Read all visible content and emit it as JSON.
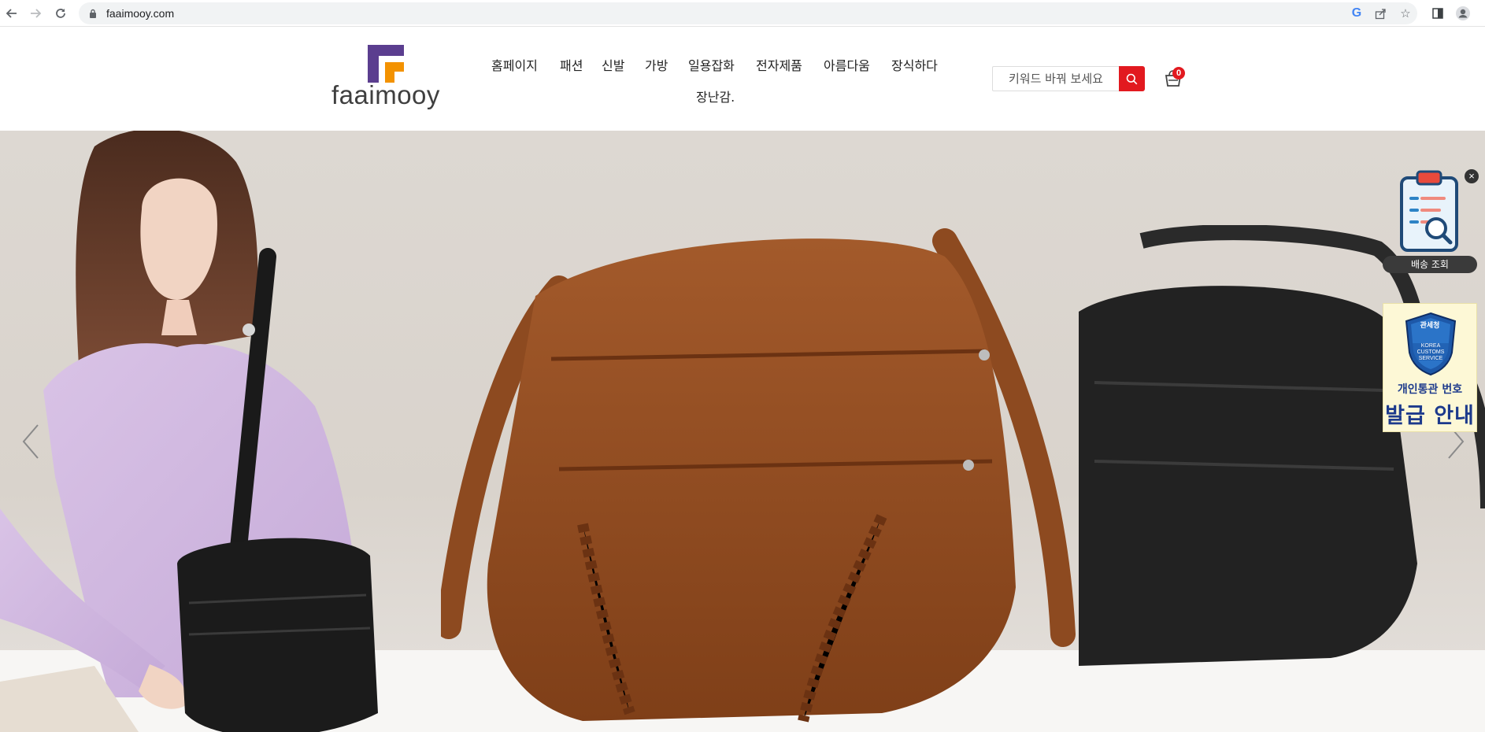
{
  "browser": {
    "url": "faaimooy.com",
    "icons": [
      "back-arrow-icon",
      "forward-arrow-icon",
      "reload-icon",
      "lock-icon",
      "google-icon",
      "share-icon",
      "star-icon",
      "side-panel-icon",
      "profile-icon"
    ]
  },
  "header": {
    "logo_text": "faaimooy",
    "menu": [
      "홈페이지",
      "패션",
      "신발",
      "가방",
      "일용잡화",
      "전자제품",
      "아름다움",
      "장식하다",
      "장난감."
    ],
    "search_placeholder": "키워드 바꿔 보세요",
    "cart_count": "0"
  },
  "widgets": {
    "track_label": "배송 조회",
    "close": "×",
    "customs_badge_text": "관세청",
    "customs_badge_sub": "KOREA CUSTOMS SERVICE",
    "customs_line1": "개인통관 번호",
    "customs_line2": "발급 안내"
  },
  "colors": {
    "accent_red": "#e2191f",
    "logo_purple": "#5b3e8f",
    "logo_orange": "#f39200",
    "customs_blue": "#1d3a8c"
  }
}
